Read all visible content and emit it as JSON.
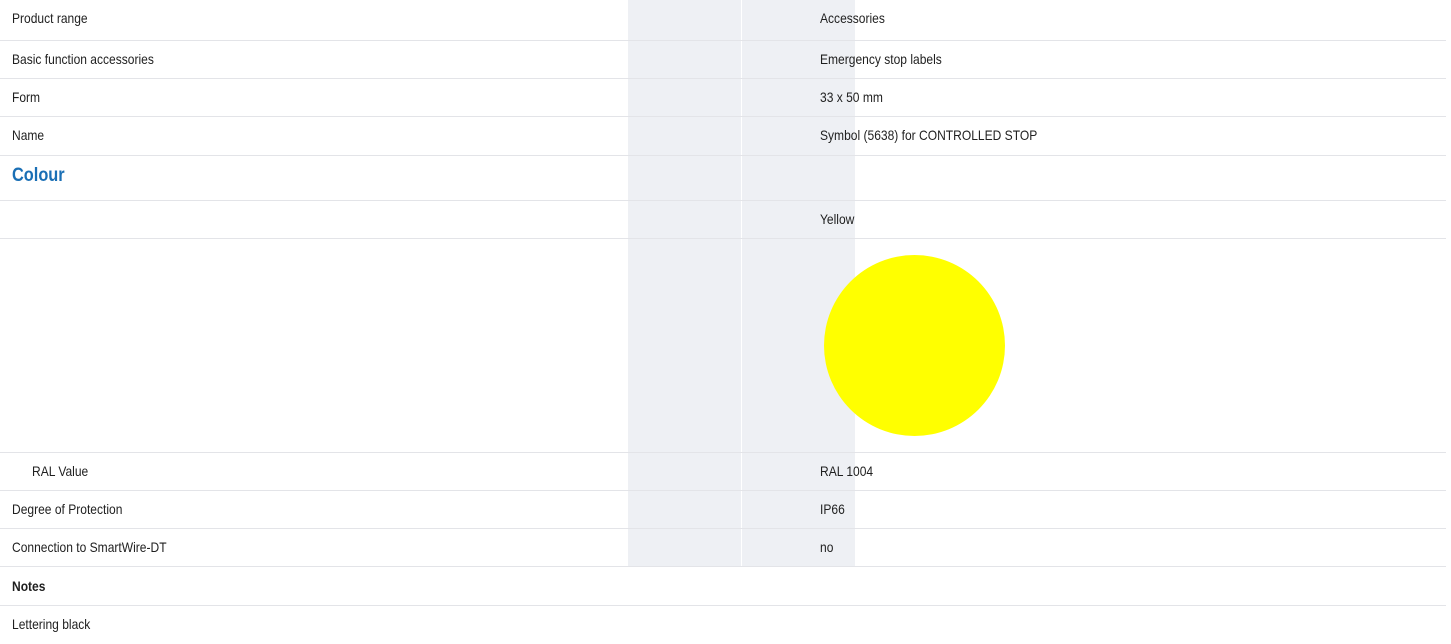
{
  "rows": [
    {
      "label": "Product range",
      "value": "Accessories"
    },
    {
      "label": "Basic function accessories",
      "value": "Emergency stop labels"
    },
    {
      "label": "Form",
      "value": "33 x 50 mm"
    },
    {
      "label": "Name",
      "value": "Symbol (5638) for CONTROLLED STOP"
    }
  ],
  "colour": {
    "heading": "Colour",
    "name": "Yellow",
    "swatch_hex": "#ffff00",
    "ral_label": "RAL Value",
    "ral_value": "RAL 1004"
  },
  "rows2": [
    {
      "label": "Degree of Protection",
      "value": "IP66"
    },
    {
      "label": "Connection to SmartWire-DT",
      "value": "no"
    }
  ],
  "notes": {
    "heading": "Notes",
    "text": "Lettering black"
  }
}
